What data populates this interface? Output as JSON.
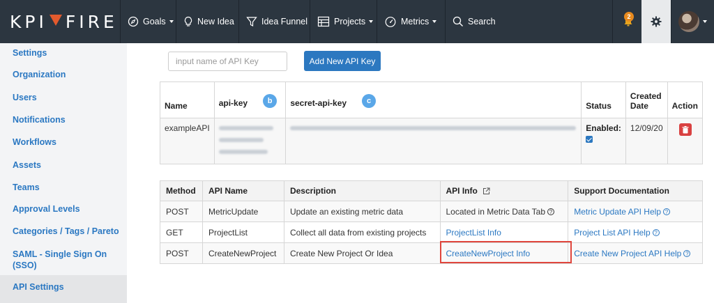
{
  "brand": {
    "logo_left": "KPI",
    "logo_right": "FIRE"
  },
  "nav": {
    "goals": "Goals",
    "new_idea": "New Idea",
    "idea_funnel": "Idea Funnel",
    "projects": "Projects",
    "metrics": "Metrics",
    "search": "Search",
    "notifications_count": "2"
  },
  "sidebar": {
    "items": [
      "Settings",
      "Organization",
      "Users",
      "Notifications",
      "Workflows",
      "Assets",
      "Teams",
      "Approval Levels",
      "Categories / Tags / Pareto",
      "SAML - Single Sign On (SSO)",
      "API Settings"
    ],
    "active": "API Settings"
  },
  "api_key_form": {
    "placeholder": "input name of API Key",
    "add_button": "Add New API Key"
  },
  "keys_table": {
    "headers": {
      "name": "Name",
      "api_key": "api-key",
      "secret": "secret-api-key",
      "status": "Status",
      "created": "Created Date",
      "action": "Action"
    },
    "markers": {
      "api_key": "b",
      "secret": "c"
    },
    "rows": [
      {
        "name": "exampleAPI",
        "status": "Enabled:",
        "enabled": true,
        "created": "12/09/20"
      }
    ]
  },
  "api_table": {
    "headers": {
      "method": "Method",
      "name": "API Name",
      "description": "Description",
      "info": "API Info",
      "docs": "Support Documentation"
    },
    "rows": [
      {
        "method": "POST",
        "name": "MetricUpdate",
        "description": "Update an existing metric data",
        "info": "Located in Metric Data Tab",
        "docs": "Metric Update API Help"
      },
      {
        "method": "GET",
        "name": "ProjectList",
        "description": "Collect all data from existing projects",
        "info": "ProjectList Info",
        "docs": "Project List API Help"
      },
      {
        "method": "POST",
        "name": "CreateNewProject",
        "description": "Create New Project Or Idea",
        "info": "CreateNewProject Info",
        "docs": "Create New Project API Help"
      }
    ]
  },
  "colors": {
    "nav_bg": "#2c3640",
    "accent": "#2c78c0",
    "logo_mark": "#e35a2d",
    "highlight": "#e0463d"
  }
}
